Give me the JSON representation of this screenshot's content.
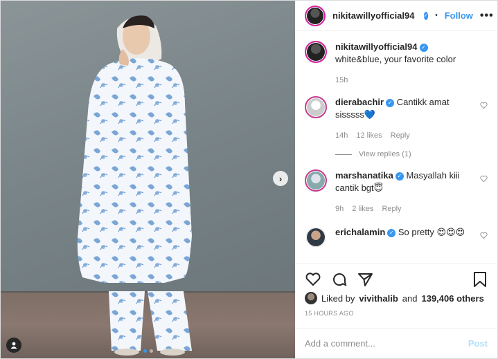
{
  "post": {
    "username": "nikitawillyofficial94",
    "follow_label": "Follow",
    "separator": "•",
    "more_label": "•••"
  },
  "caption": {
    "username": "nikitawillyofficial94",
    "text": "white&blue, your favorite color",
    "time": "15h"
  },
  "comments": [
    {
      "username": "dierabachir",
      "text": "Cantikk amat sisssss💙",
      "time": "14h",
      "likes": "12 likes",
      "reply": "Reply",
      "verified": true
    },
    {
      "username": "marshanatika",
      "text": "Masyallah kiii cantik bgt😇",
      "time": "9h",
      "likes": "2 likes",
      "reply": "Reply",
      "verified": true
    },
    {
      "username": "erichalamin",
      "text": "So pretty 😍😍😍",
      "verified": true
    }
  ],
  "view_replies": "View replies (1)",
  "liked_by": {
    "prefix": "Liked by",
    "user": "vivithalib",
    "suffix": "and",
    "count": "139,406 others"
  },
  "timestamp": "15 HOURS AGO",
  "add_comment": {
    "placeholder": "Add a comment...",
    "post_label": "Post"
  },
  "colors": {
    "accent": "#3897f0",
    "post_disabled": "#b2dffc",
    "muted": "#8e8e8e"
  },
  "icons": [
    "heart-icon",
    "comment-icon",
    "share-icon",
    "bookmark-icon",
    "tag-icon",
    "chevron-right-icon",
    "verified-icon"
  ],
  "carousel": {
    "count": 2,
    "active": 1
  }
}
